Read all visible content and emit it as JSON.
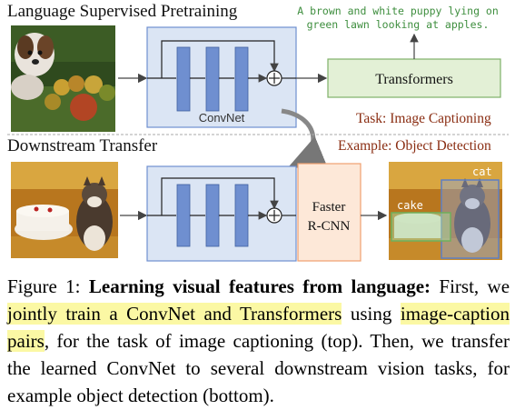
{
  "top_section": {
    "title": "Language Supervised Pretraining",
    "generated_caption": "A brown and white puppy lying on green lawn looking at apples.",
    "transformers_label": "Transformers",
    "convnet_label": "ConvNet",
    "task_label": "Task: Image Captioning"
  },
  "bottom_section": {
    "title": "Downstream Transfer",
    "example_label": "Example: Object Detection",
    "detector_label_line1": "Faster",
    "detector_label_line2": "R-CNN",
    "box_labels": [
      "cake",
      "cat"
    ]
  },
  "figure_caption": {
    "prefix": "Figure 1: ",
    "bold_title": "Learning visual features from language:",
    "s1": " First, we ",
    "h1": "jointly train a ConvNet and Transformers",
    "s2": " using ",
    "h2": "image-caption pairs",
    "s3": ", for the task of image captioning (top). Then, we transfer the learned ConvNet to several downstream vision tasks, for example object detection (bottom)."
  },
  "colors": {
    "convnet_fill": "#dbe5f4",
    "convnet_block": "#6f8fd0",
    "transformer_fill": "#e3f0d6",
    "transformer_border": "#7fb069",
    "detector_fill": "#fde8d8",
    "detector_border": "#f0a070",
    "label_red": "#8a2d12",
    "caption_green": "#3e8e3e",
    "highlight": "#fbf8a4"
  }
}
